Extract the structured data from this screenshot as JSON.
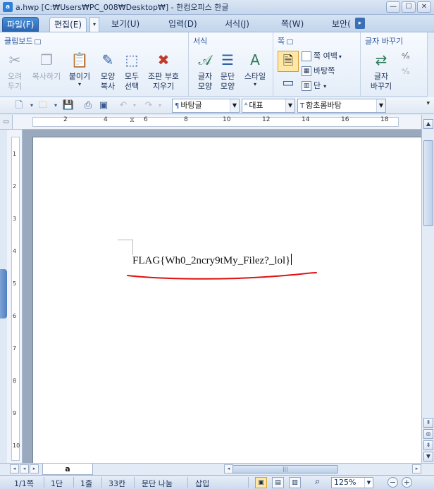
{
  "window": {
    "title": "a.hwp [C:₩Users₩PC_008₩Desktop₩] - 한컴오피스 한글",
    "app_icon": "hwp-icon",
    "buttons": {
      "minimize": "—",
      "maximize": "☐",
      "close": "✕"
    }
  },
  "menu": {
    "tabs": [
      {
        "label": "파일(F)"
      },
      {
        "label": "편집(E)"
      },
      {
        "label": "보기(U)"
      },
      {
        "label": "입력(D)"
      },
      {
        "label": "서식(J)"
      },
      {
        "label": "쪽(W)"
      },
      {
        "label": "보안("
      }
    ],
    "active_tab": "편집(E)"
  },
  "ribbon": {
    "clipboard": {
      "title": "클립보드",
      "cut": "오려\n두기",
      "copy": "복사하기",
      "paste": "붙이기",
      "format_copy": "모양\n복사",
      "select_all": "모두\n선택",
      "remove_codes": "조판 부호\n지우기"
    },
    "format": {
      "title": "서식",
      "char_shape": "글자\n모양",
      "para_shape": "문단\n모양",
      "style": "스타일"
    },
    "page": {
      "title": "쪽",
      "margin": "쪽 여백",
      "background": "바탕쪽",
      "columns": "단"
    },
    "replace": {
      "title": "글자 바꾸기",
      "replace_btn": "글자\n바꾸기"
    }
  },
  "toolbar": {
    "style_combo": "바탕글",
    "lang_combo": "대표",
    "font_combo": "함초롬바탕"
  },
  "ruler": {
    "h_numbers": [
      "2",
      "4",
      "6",
      "8",
      "10",
      "12",
      "14",
      "16",
      "18"
    ],
    "v_numbers": [
      "1",
      "2",
      "3",
      "4",
      "5",
      "6",
      "7",
      "8",
      "9",
      "10"
    ]
  },
  "document": {
    "text": "FLAG{Wh0_2ncry9tMy_Filez?_lol}",
    "underline_color": "#e01010"
  },
  "sheet": {
    "tab_label": "a"
  },
  "status": {
    "page": "1/1쪽",
    "section": "1단",
    "line": "1줄",
    "column": "33칸",
    "split": "문단 나눔",
    "insert_mode": "삽입",
    "zoom": "125%"
  },
  "colors": {
    "accent": "#2c5aa0",
    "file_tab": "#2b66b3",
    "ribbon_bg": "#e4edf8"
  }
}
